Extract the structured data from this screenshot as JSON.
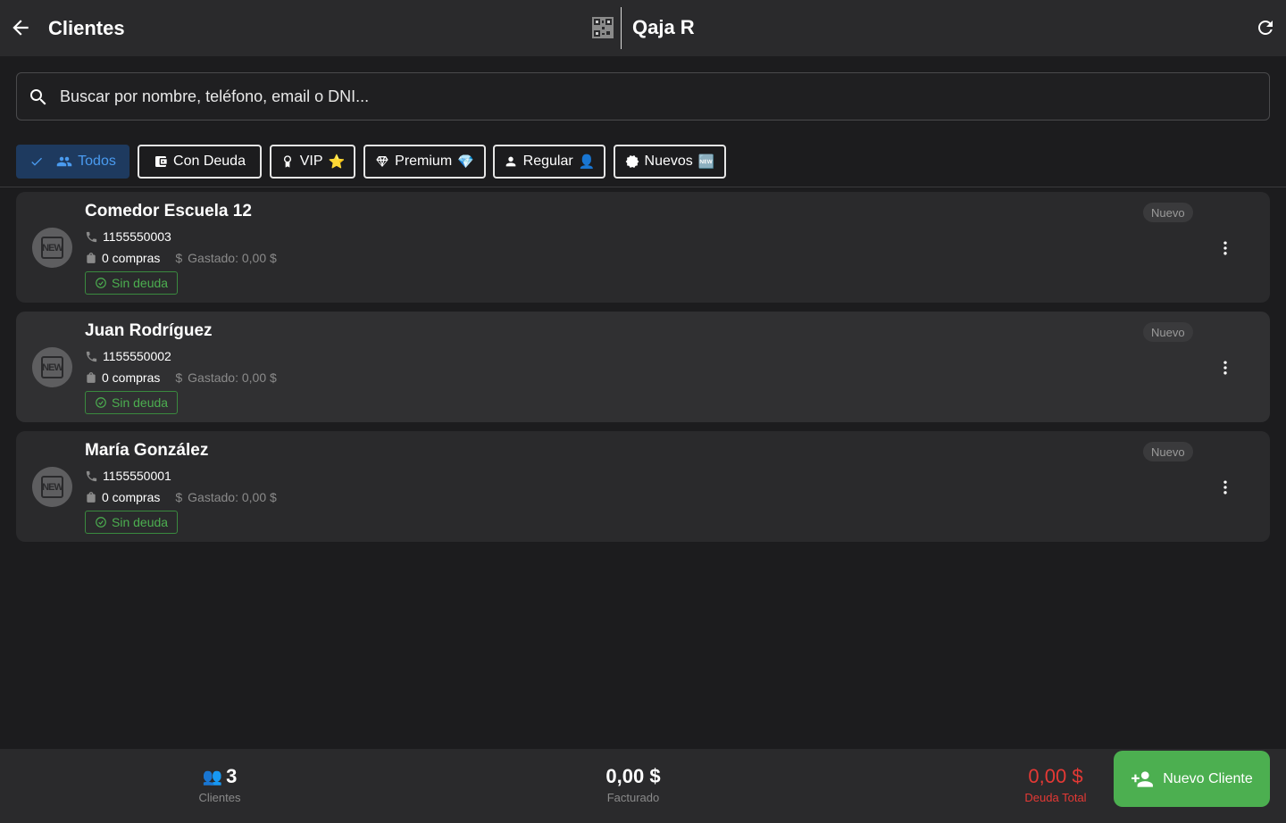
{
  "header": {
    "title": "Clientes",
    "brand_name": "Qaja R"
  },
  "search": {
    "placeholder": "Buscar por nombre, teléfono, email o DNI..."
  },
  "filters": [
    {
      "label": "Todos",
      "icon": "people-icon",
      "selected": true
    },
    {
      "label": "Con Deuda",
      "icon": "wallet-icon",
      "selected": false
    },
    {
      "label": "VIP",
      "icon": "award-icon",
      "emoji": "⭐",
      "selected": false
    },
    {
      "label": "Premium",
      "icon": "diamond-icon",
      "emoji": "💎",
      "selected": false
    },
    {
      "label": "Regular",
      "icon": "person-icon",
      "emoji": "👤",
      "selected": false
    },
    {
      "label": "Nuevos",
      "icon": "new-badge-icon",
      "emoji": "🆕",
      "selected": false
    }
  ],
  "clients": [
    {
      "name": "Comedor Escuela 12",
      "phone": "1155550003",
      "purchases": "0 compras",
      "spent": "Gastado: 0,00 $",
      "debt_status": "Sin deuda",
      "tier": "Nuevo",
      "avatar_text": "NEW"
    },
    {
      "name": "Juan Rodríguez",
      "phone": "1155550002",
      "purchases": "0 compras",
      "spent": "Gastado: 0,00 $",
      "debt_status": "Sin deuda",
      "tier": "Nuevo",
      "avatar_text": "NEW"
    },
    {
      "name": "María González",
      "phone": "1155550001",
      "purchases": "0 compras",
      "spent": "Gastado: 0,00 $",
      "debt_status": "Sin deuda",
      "tier": "Nuevo",
      "avatar_text": "NEW"
    }
  ],
  "footer": {
    "clients_count": "3",
    "clients_emoji": "👥",
    "clients_label": "Clientes",
    "billed_value": "0,00 $",
    "billed_label": "Facturado",
    "debt_value": "0,00 $",
    "debt_label": "Deuda Total",
    "new_client_label": "Nuevo Cliente"
  },
  "colors": {
    "background": "#1c1c1e",
    "surface": "#2a2a2c",
    "accent_blue": "#4a9bf0",
    "success_green": "#4caf50",
    "danger_red": "#e53935"
  }
}
